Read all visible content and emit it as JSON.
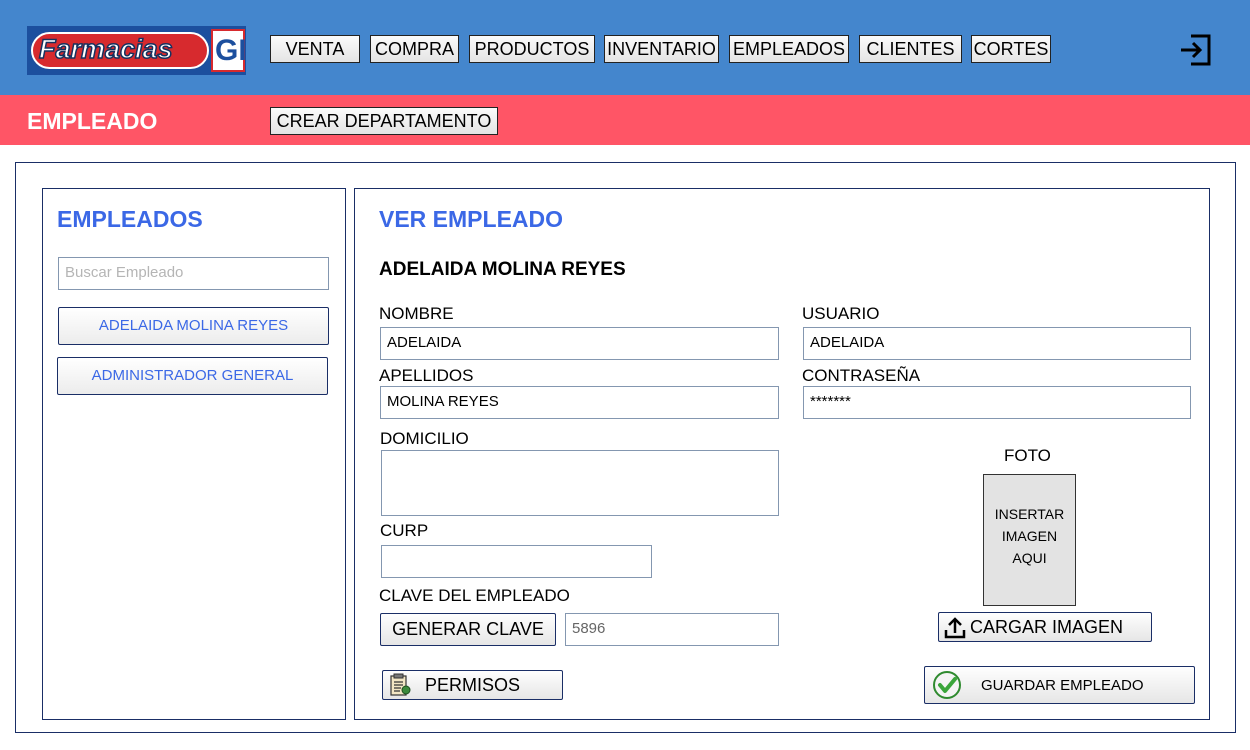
{
  "header": {
    "logo_text": "Farmacias",
    "logo_mark": "GI",
    "nav": [
      "VENTA",
      "COMPRA",
      "PRODUCTOS",
      "INVENTARIO",
      "EMPLEADOS",
      "CLIENTES",
      "CORTES"
    ],
    "logout_icon": "logout-icon"
  },
  "subheader": {
    "title": "EMPLEADO",
    "create_department": "CREAR DEPARTAMENTO"
  },
  "sidebar": {
    "heading": "EMPLEADOS",
    "search_placeholder": "Buscar Empleado",
    "employees": [
      "ADELAIDA MOLINA REYES",
      "ADMINISTRADOR GENERAL"
    ]
  },
  "detail": {
    "heading": "VER EMPLEADO",
    "employee_name": "ADELAIDA MOLINA REYES",
    "fields": {
      "nombre_label": "NOMBRE",
      "nombre_value": "ADELAIDA",
      "usuario_label": "USUARIO",
      "usuario_value": "ADELAIDA",
      "apellidos_label": "APELLIDOS",
      "apellidos_value": "MOLINA REYES",
      "contrasena_label": "CONTRASEÑA",
      "contrasena_value": "*******",
      "domicilio_label": "DOMICILIO",
      "domicilio_value": "",
      "curp_label": "CURP",
      "curp_value": "",
      "clave_label": "CLAVE DEL EMPLEADO",
      "clave_value": "5896"
    },
    "generate_key": "GENERAR CLAVE",
    "permissions": "PERMISOS",
    "photo_label": "FOTO",
    "photo_placeholder_lines": [
      "INSERTAR",
      "IMAGEN",
      "AQUI"
    ],
    "upload_image": "CARGAR IMAGEN",
    "save_employee": "GUARDAR EMPLEADO"
  },
  "colors": {
    "topbar": "#4486cd",
    "subbar": "#ff5566",
    "heading_blue": "#3b68e6",
    "panel_border": "#1a2e66"
  }
}
